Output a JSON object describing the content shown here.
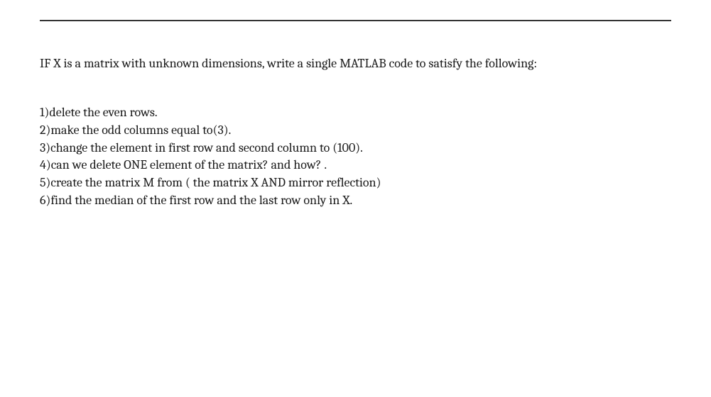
{
  "prompt": "IF X is a matrix with unknown dimensions, write a single MATLAB code  to satisfy the following:",
  "items": [
    "1)delete the even rows.",
    "2)make the odd columns equal to(3).",
    "3)change the element in first row and second column to (100).",
    "4)can we delete ONE element of the matrix? and how? .",
    "5)create the matrix M from ( the matrix X  AND mirror reflection)",
    "6)find the median of the first row and the last row only in X."
  ]
}
